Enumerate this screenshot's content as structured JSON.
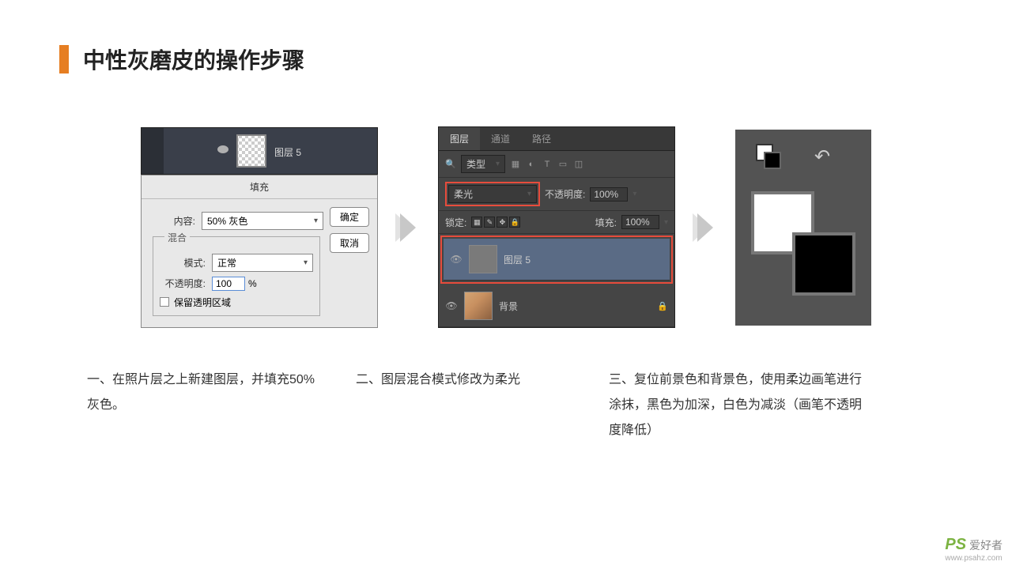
{
  "header": {
    "title": "中性灰磨皮的操作步骤"
  },
  "panel1": {
    "layer_label": "图层 5",
    "dialog": {
      "title": "填充",
      "content_label": "内容:",
      "content_value": "50% 灰色",
      "ok": "确定",
      "cancel": "取消",
      "blend_group": "混合",
      "mode_label": "模式:",
      "mode_value": "正常",
      "opacity_label": "不透明度:",
      "opacity_value": "100",
      "opacity_unit": "%",
      "preserve": "保留透明区域"
    }
  },
  "panel2": {
    "tabs": {
      "layers": "图层",
      "channels": "通道",
      "paths": "路径"
    },
    "kind_label": "类型",
    "blend_mode": "柔光",
    "opacity_label": "不透明度:",
    "opacity_value": "100%",
    "lock_label": "锁定:",
    "fill_label": "填充:",
    "fill_value": "100%",
    "layer5": "图层 5",
    "background": "背景"
  },
  "captions": {
    "c1": "一、在照片层之上新建图层，并填充50%灰色。",
    "c2": "二、图层混合模式修改为柔光",
    "c3": "三、复位前景色和背景色，使用柔边画笔进行涂抹，黑色为加深，白色为减淡（画笔不透明度降低）"
  },
  "watermark": {
    "brand": "PS",
    "text": "爱好者",
    "url": "www.psahz.com"
  }
}
